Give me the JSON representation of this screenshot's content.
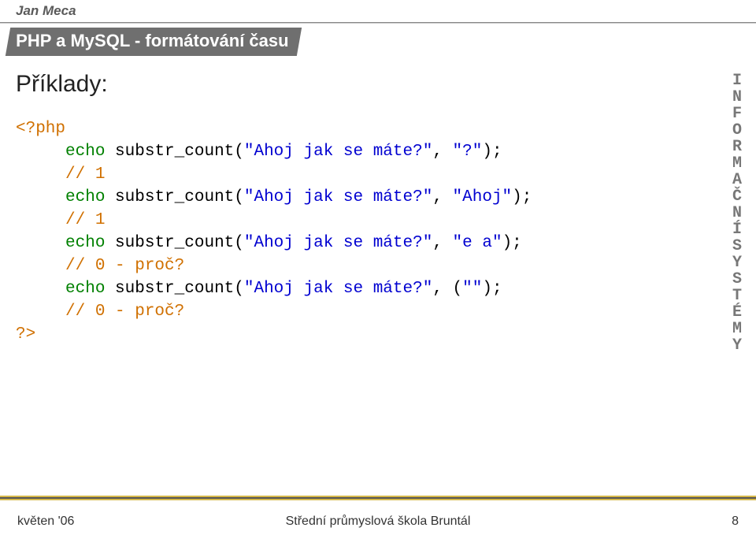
{
  "author": "Jan Meca",
  "title": "PHP a MySQL - formátování času",
  "heading": "Příklady:",
  "code": {
    "open_tag": "<?php",
    "l1_echo": "echo",
    "l1_fn_open": "substr_count(",
    "l1_str1": "\"Ahoj jak se máte?\"",
    "l1_comma": ", ",
    "l1_str2": "\"?\"",
    "l1_close": ");",
    "c1": "// 1",
    "l2_echo": "echo",
    "l2_fn_open": "substr_count(",
    "l2_str1": "\"Ahoj jak se máte?\"",
    "l2_comma": ", ",
    "l2_str2": "\"Ahoj\"",
    "l2_close": ");",
    "c2": "// 1",
    "l3_echo": "echo",
    "l3_fn_open": "substr_count(",
    "l3_str1": "\"Ahoj jak se máte?\"",
    "l3_comma": ", ",
    "l3_str2": "\"e a\"",
    "l3_close": ");",
    "c3": "// 0 - proč?",
    "l4_echo": "echo",
    "l4_fn_open": "substr_count(",
    "l4_str1": "\"Ahoj jak se máte?\"",
    "l4_comma": ", (",
    "l4_str2": "\"\"",
    "l4_close": ");",
    "c4": "// 0 - proč?",
    "close_tag": "?>"
  },
  "vert": [
    "I",
    "N",
    "F",
    "O",
    "R",
    "M",
    "A",
    "Č",
    "N",
    "Í",
    "",
    "S",
    "Y",
    "S",
    "T",
    "É",
    "M",
    "Y"
  ],
  "footer": {
    "left": "květen '06",
    "center": "Střední průmyslová škola Bruntál",
    "right": "8"
  }
}
